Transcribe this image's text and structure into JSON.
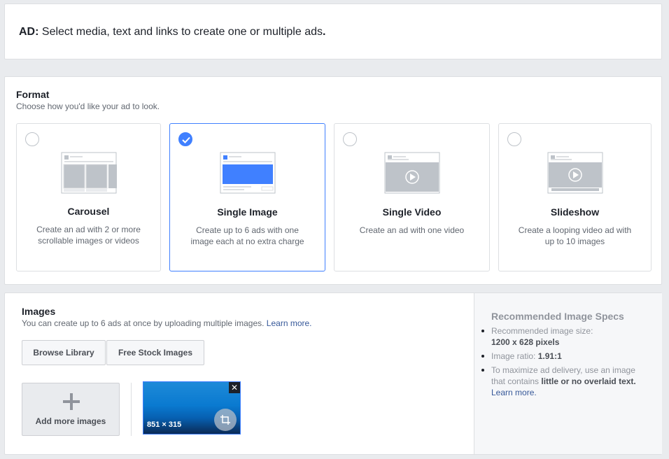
{
  "ad": {
    "label": "AD:",
    "text": "Select media, text and links to create one or multiple ads",
    "period": "."
  },
  "format": {
    "title": "Format",
    "subtitle": "Choose how you'd like your ad to look.",
    "cards": [
      {
        "title": "Carousel",
        "desc": "Create an ad with 2 or more scrollable images or videos",
        "selected": false
      },
      {
        "title": "Single Image",
        "desc": "Create up to 6 ads with one image each at no extra charge",
        "selected": true
      },
      {
        "title": "Single Video",
        "desc": "Create an ad with one video",
        "selected": false
      },
      {
        "title": "Slideshow",
        "desc": "Create a looping video ad with up to 10 images",
        "selected": false
      }
    ]
  },
  "images": {
    "title": "Images",
    "subtitle": "You can create up to 6 ads at once by uploading multiple images.",
    "learn_more": "Learn more.",
    "browse_library": "Browse Library",
    "free_stock": "Free Stock Images",
    "add_more": "Add more images",
    "thumb_dims": "851 × 315",
    "close_glyph": "✕"
  },
  "specs": {
    "title": "Recommended Image Specs",
    "size_label": "Recommended image size:",
    "size_value": "1200 x 628 pixels",
    "ratio_label": "Image ratio:",
    "ratio_value": "1.91:1",
    "delivery_pre": "To maximize ad delivery, use an image that contains",
    "delivery_bold": "little or no overlaid text.",
    "learn_more": "Learn more."
  },
  "colors": {
    "accent": "#4080ff",
    "link": "#365899",
    "background": "#e9ebee"
  }
}
